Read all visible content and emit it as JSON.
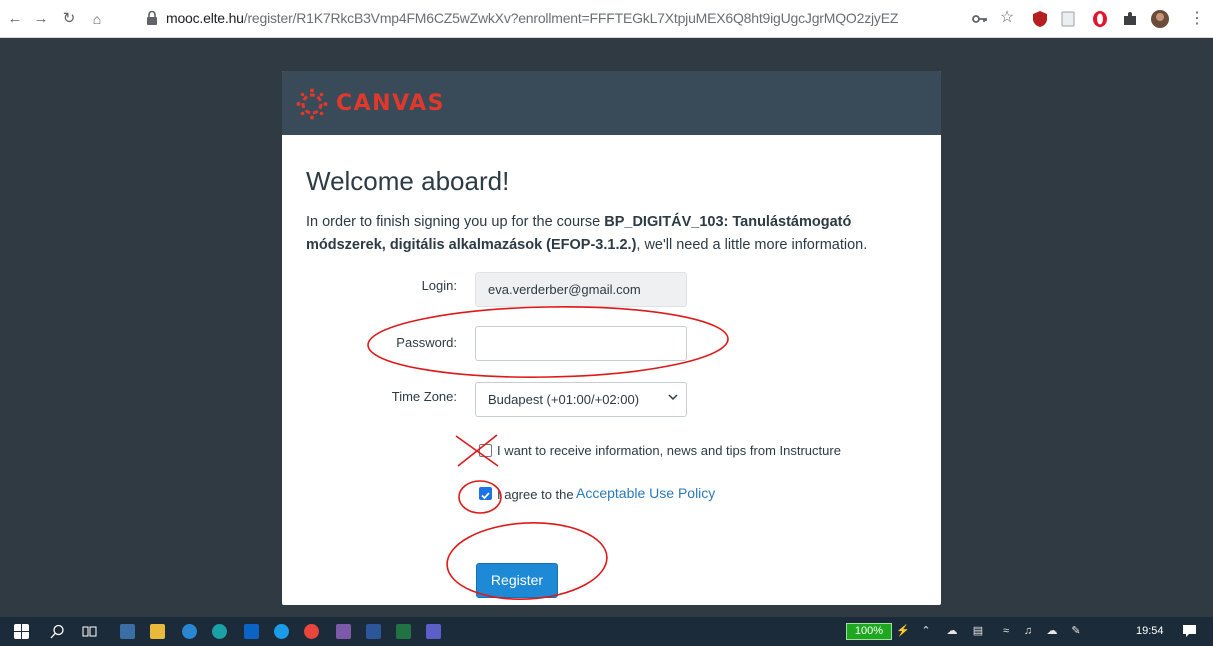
{
  "browser": {
    "url_host": "mooc.elte.hu",
    "url_path": "/register/R1K7RkcB3Vmp4FM6CZ5wZwkXv?enrollment=FFFTEGkL7XtpjuMEX6Q8ht9igUgcJgrMQO2zjyEZ"
  },
  "header": {
    "brand": "CANVAS"
  },
  "main": {
    "heading": "Welcome aboard!",
    "intro_prefix": "In order to finish signing you up for the course ",
    "course_name": "BP_DIGITÁV_103: Tanulástámogató módszerek, digitális alkalmazások (EFOP-3.1.2.)",
    "intro_suffix": ", we'll need a little more information."
  },
  "form": {
    "login_label": "Login:",
    "login_value": "eva.verderber@gmail.com",
    "password_label": "Password:",
    "timezone_label": "Time Zone:",
    "timezone_value": "Budapest (+01:00/+02:00)",
    "news_label": "I want to receive information, news and tips from Instructure",
    "agree_prefix": "I agree to the ",
    "agree_link": "Acceptable Use Policy",
    "register_label": "Register"
  },
  "taskbar": {
    "battery": "100%",
    "clock": "19:54"
  },
  "colors": {
    "brand_red": "#e0392b",
    "header_bg": "#394b58",
    "primary_button": "#1e8ad6",
    "annotation": "#e01818"
  }
}
